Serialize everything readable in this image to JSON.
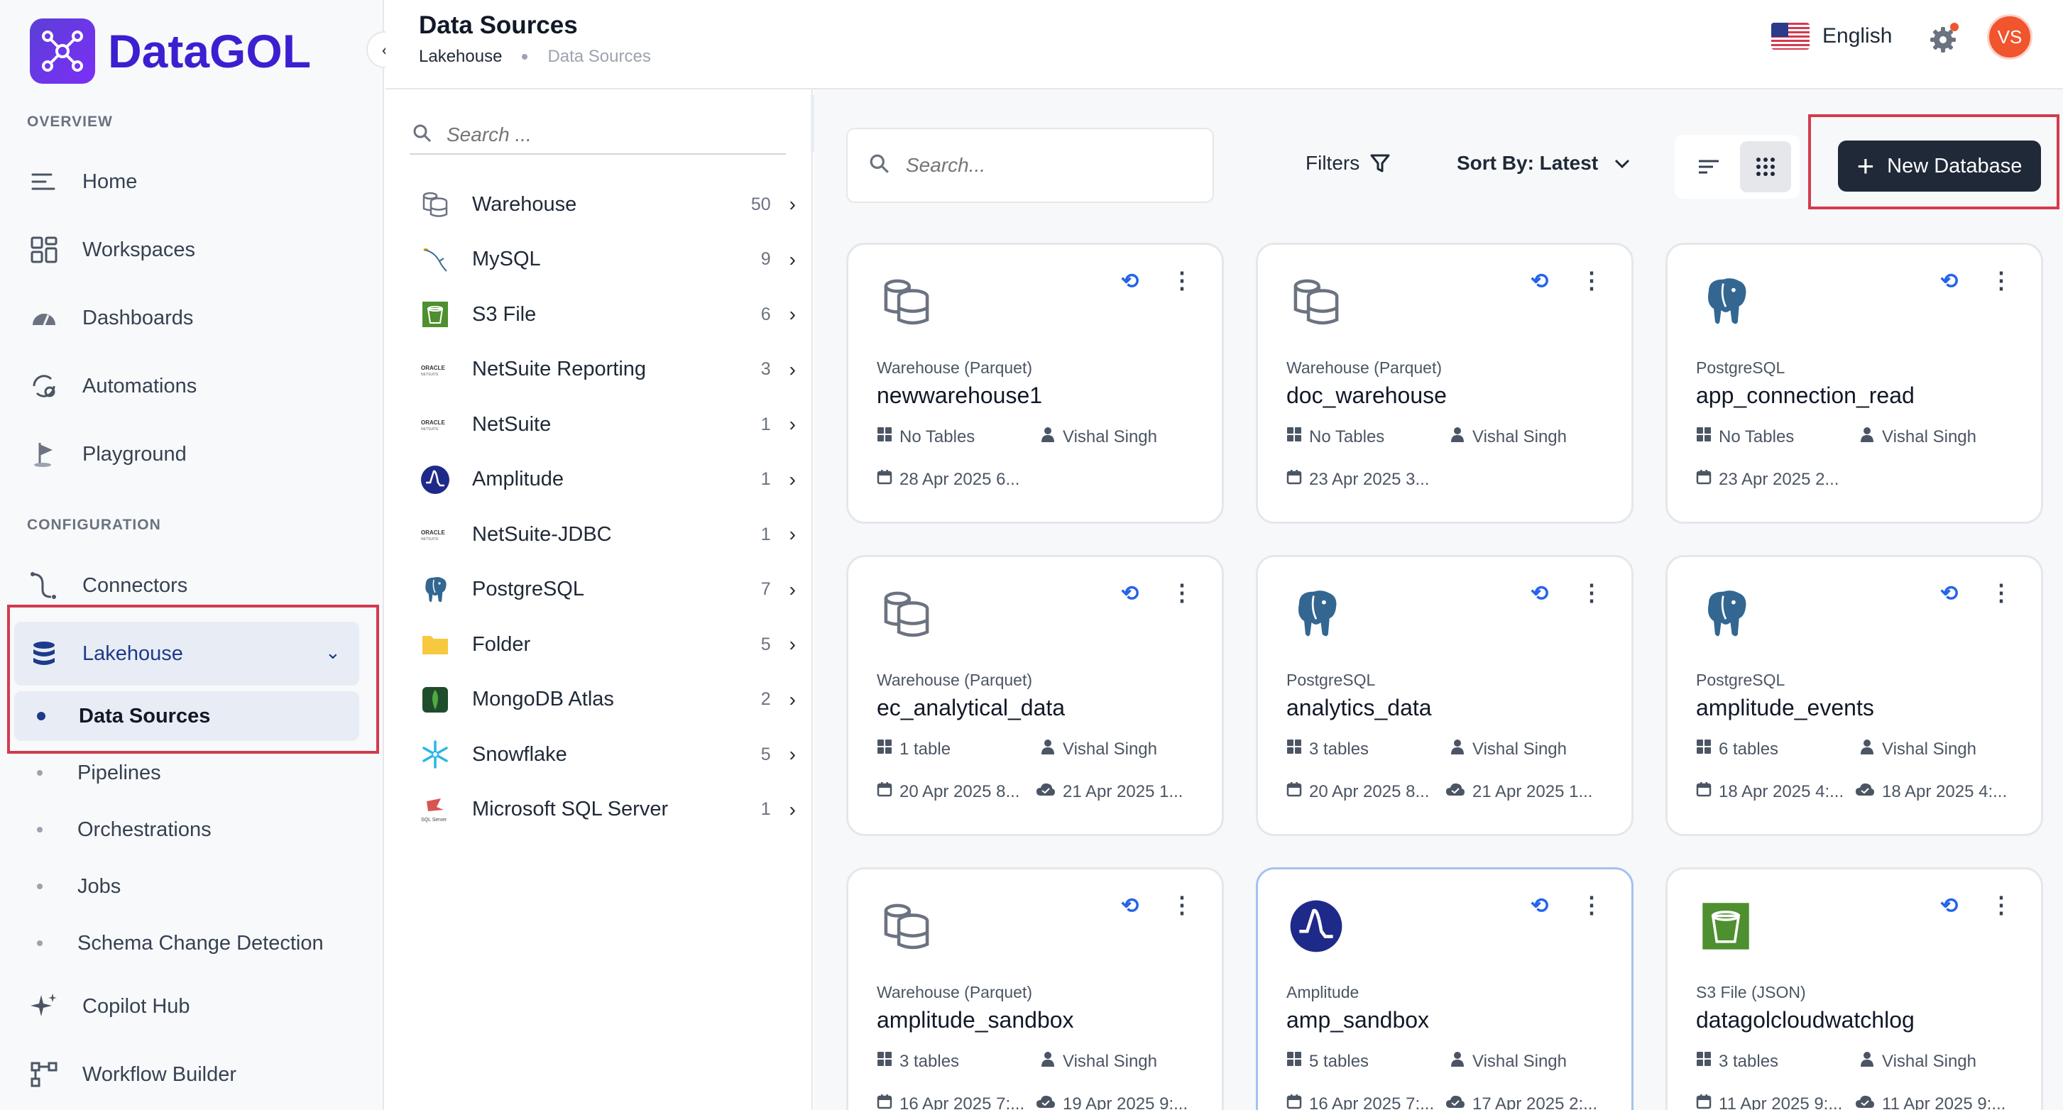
{
  "app": {
    "name": "DataGOL"
  },
  "sidebar": {
    "overview_label": "OVERVIEW",
    "configuration_label": "CONFIGURATION",
    "overview_items": [
      {
        "label": "Home",
        "icon": "home-icon"
      },
      {
        "label": "Workspaces",
        "icon": "workspaces-icon"
      },
      {
        "label": "Dashboards",
        "icon": "dashboards-icon"
      },
      {
        "label": "Automations",
        "icon": "automations-icon"
      },
      {
        "label": "Playground",
        "icon": "playground-icon"
      }
    ],
    "config_items": [
      {
        "label": "Connectors",
        "icon": "connectors-icon"
      },
      {
        "label": "Lakehouse",
        "icon": "database-icon"
      }
    ],
    "lakehouse_sub": [
      "Data Sources",
      "Pipelines",
      "Orchestrations",
      "Jobs",
      "Schema Change Detection"
    ],
    "bottom_items": [
      {
        "label": "Copilot Hub",
        "icon": "sparkle-icon"
      },
      {
        "label": "Workflow Builder",
        "icon": "workflow-icon"
      }
    ]
  },
  "header": {
    "title": "Data Sources",
    "breadcrumb": [
      "Lakehouse",
      "Data Sources"
    ],
    "language": "English",
    "avatar_initials": "VS"
  },
  "type_panel": {
    "search_placeholder": "Search ...",
    "items": [
      {
        "label": "Warehouse",
        "count": "50",
        "icon": "warehouse-icon"
      },
      {
        "label": "MySQL",
        "count": "9",
        "icon": "mysql-icon"
      },
      {
        "label": "S3 File",
        "count": "6",
        "icon": "s3-icon"
      },
      {
        "label": "NetSuite Reporting",
        "count": "3",
        "icon": "oracle-netsuite-icon"
      },
      {
        "label": "NetSuite",
        "count": "1",
        "icon": "oracle-netsuite-icon"
      },
      {
        "label": "Amplitude",
        "count": "1",
        "icon": "amplitude-icon"
      },
      {
        "label": "NetSuite-JDBC",
        "count": "1",
        "icon": "oracle-netsuite-icon"
      },
      {
        "label": "PostgreSQL",
        "count": "7",
        "icon": "postgresql-icon"
      },
      {
        "label": "Folder",
        "count": "5",
        "icon": "folder-icon"
      },
      {
        "label": "MongoDB Atlas",
        "count": "2",
        "icon": "mongodb-icon"
      },
      {
        "label": "Snowflake",
        "count": "5",
        "icon": "snowflake-icon"
      },
      {
        "label": "Microsoft SQL Server",
        "count": "1",
        "icon": "sqlserver-icon"
      }
    ]
  },
  "toolbar": {
    "search_placeholder": "Search...",
    "filters_label": "Filters",
    "sort_label": "Sort By: Latest",
    "new_database_label": "New Database"
  },
  "cards": [
    {
      "type": "Warehouse (Parquet)",
      "name": "newwarehouse1",
      "tables": "No Tables",
      "owner": "Vishal Singh",
      "created": "28 Apr 2025 6...",
      "synced": "",
      "icon": "warehouse-icon"
    },
    {
      "type": "Warehouse (Parquet)",
      "name": "doc_warehouse",
      "tables": "No Tables",
      "owner": "Vishal Singh",
      "created": "23 Apr 2025 3...",
      "synced": "",
      "icon": "warehouse-icon"
    },
    {
      "type": "PostgreSQL",
      "name": "app_connection_read",
      "tables": "No Tables",
      "owner": "Vishal Singh",
      "created": "23 Apr 2025 2...",
      "synced": "",
      "icon": "postgresql-icon"
    },
    {
      "type": "Warehouse (Parquet)",
      "name": "ec_analytical_data",
      "tables": "1 table",
      "owner": "Vishal Singh",
      "created": "20 Apr 2025 8...",
      "synced": "21 Apr 2025 1...",
      "icon": "warehouse-icon"
    },
    {
      "type": "PostgreSQL",
      "name": "analytics_data",
      "tables": "3 tables",
      "owner": "Vishal Singh",
      "created": "20 Apr 2025 8...",
      "synced": "21 Apr 2025 1...",
      "icon": "postgresql-icon"
    },
    {
      "type": "PostgreSQL",
      "name": "amplitude_events",
      "tables": "6 tables",
      "owner": "Vishal Singh",
      "created": "18 Apr 2025 4:...",
      "synced": "18 Apr 2025 4:...",
      "icon": "postgresql-icon"
    },
    {
      "type": "Warehouse (Parquet)",
      "name": "amplitude_sandbox",
      "tables": "3 tables",
      "owner": "Vishal Singh",
      "created": "16 Apr 2025 7:...",
      "synced": "19 Apr 2025 9:...",
      "icon": "warehouse-icon"
    },
    {
      "type": "Amplitude",
      "name": "amp_sandbox",
      "tables": "5 tables",
      "owner": "Vishal Singh",
      "created": "16 Apr 2025 7:...",
      "synced": "17 Apr 2025 2:...",
      "icon": "amplitude-icon"
    },
    {
      "type": "S3 File (JSON)",
      "name": "datagolcloudwatchlog",
      "tables": "3 tables",
      "owner": "Vishal Singh",
      "created": "11 Apr 2025 9:...",
      "synced": "11 Apr 2025 9:...",
      "icon": "s3-icon"
    }
  ],
  "colors": {
    "brand": "#3b1fd0",
    "accent": "#2563eb",
    "highlight": "#d33b4f",
    "primary_button": "#1f2937"
  }
}
